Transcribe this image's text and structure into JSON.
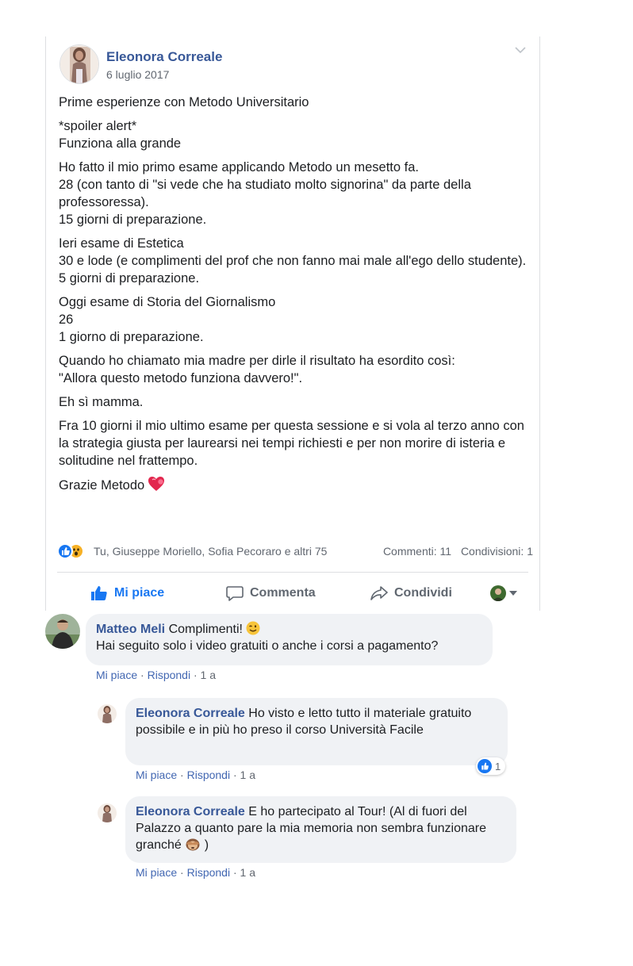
{
  "post": {
    "author": "Eleonora Correale",
    "date": "6 luglio 2017",
    "paragraphs": [
      "Prime esperienze con Metodo Universitario",
      "*spoiler alert*\nFunziona alla grande",
      "Ho fatto il mio primo esame applicando Metodo un mesetto fa.\n28 (con tanto di \"si vede che ha studiato molto signorina\" da parte della professoressa).\n15 giorni di preparazione.",
      "Ieri esame di Estetica\n30 e lode (e complimenti del prof che non fanno mai male all'ego dello studente).\n5 giorni di preparazione.",
      "Oggi esame di Storia del Giornalismo\n26\n1 giorno di preparazione.",
      "Quando ho chiamato mia madre per dirle il risultato ha esordito così:\n\"Allora questo metodo funziona davvero!\".",
      "Eh sì mamma.",
      "Fra 10 giorni il mio ultimo esame per questa sessione e si vola al terzo anno con la strategia giusta per laurearsi nei tempi richiesti e per non morire di isteria e solitudine nel frattempo."
    ],
    "closing": "Grazie Metodo",
    "closing_emoji": "heart-icon",
    "reactions": {
      "names": "Tu, Giuseppe Moriello, Sofia Pecoraro e altri 75",
      "comments": "Commenti: 11",
      "shares": "Condivisioni: 1"
    },
    "actions": {
      "like": "Mi piace",
      "comment": "Commenta",
      "share": "Condividi"
    }
  },
  "comments": [
    {
      "author": "Matteo Meli",
      "text": "Complimenti!",
      "emoji": "wink-emoji",
      "text2": "Hai seguito solo i video gratuiti o anche i corsi a pagamento?",
      "like": "Mi piace",
      "reply": "Rispondi",
      "age": "1 a"
    },
    {
      "author": "Eleonora Correale",
      "text": "Ho visto e letto tutto il materiale gratuito possibile e in più ho preso il corso Università Facile",
      "like": "Mi piace",
      "reply": "Rispondi",
      "age": "1 a",
      "reaction_count": "1"
    },
    {
      "author": "Eleonora Correale",
      "text": "E ho partecipato al Tour! (Al di fuori del Palazzo a quanto pare la mia memoria non sembra funzionare granché",
      "emoji": "see-no-evil-monkey-emoji",
      "text_end": ")",
      "like": "Mi piace",
      "reply": "Rispondi",
      "age": "1 a"
    }
  ],
  "colors": {
    "link": "#385898",
    "accent": "#1877f2",
    "meta": "#616770",
    "bubble": "#f0f2f5"
  }
}
